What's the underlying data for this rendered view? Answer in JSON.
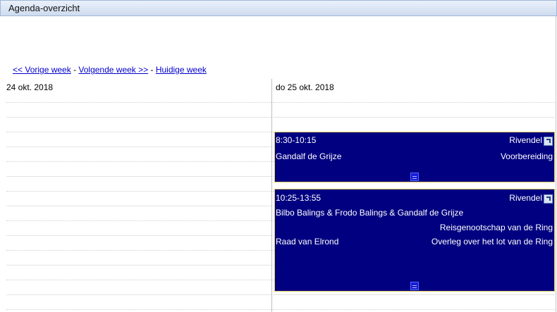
{
  "window": {
    "title": "Agenda-overzicht"
  },
  "nav": {
    "prev": "<< Vorige week",
    "sep1": " - ",
    "next": "Volgende week >>",
    "sep2": " - ",
    "current": "Huidige week"
  },
  "columns": [
    {
      "header": "24 okt. 2018"
    },
    {
      "header": "do 25 okt. 2018"
    }
  ],
  "events": [
    {
      "time": "8:30-10:15",
      "location": "Rivendel",
      "people": "Gandalf de Grijze",
      "title": "Voorbereiding"
    },
    {
      "time": "10:25-13:55",
      "location": "Rivendel",
      "people": "Bilbo Balings & Frodo Balings & Gandalf de Grijze",
      "group": "Reisgenootschap van de Ring",
      "organizer": "Raad van Elrond",
      "title": "Overleg over het lot van de Ring"
    }
  ],
  "colors": {
    "event_bg": "#000080",
    "event_border": "#d8c35a",
    "link": "#0000cc"
  }
}
